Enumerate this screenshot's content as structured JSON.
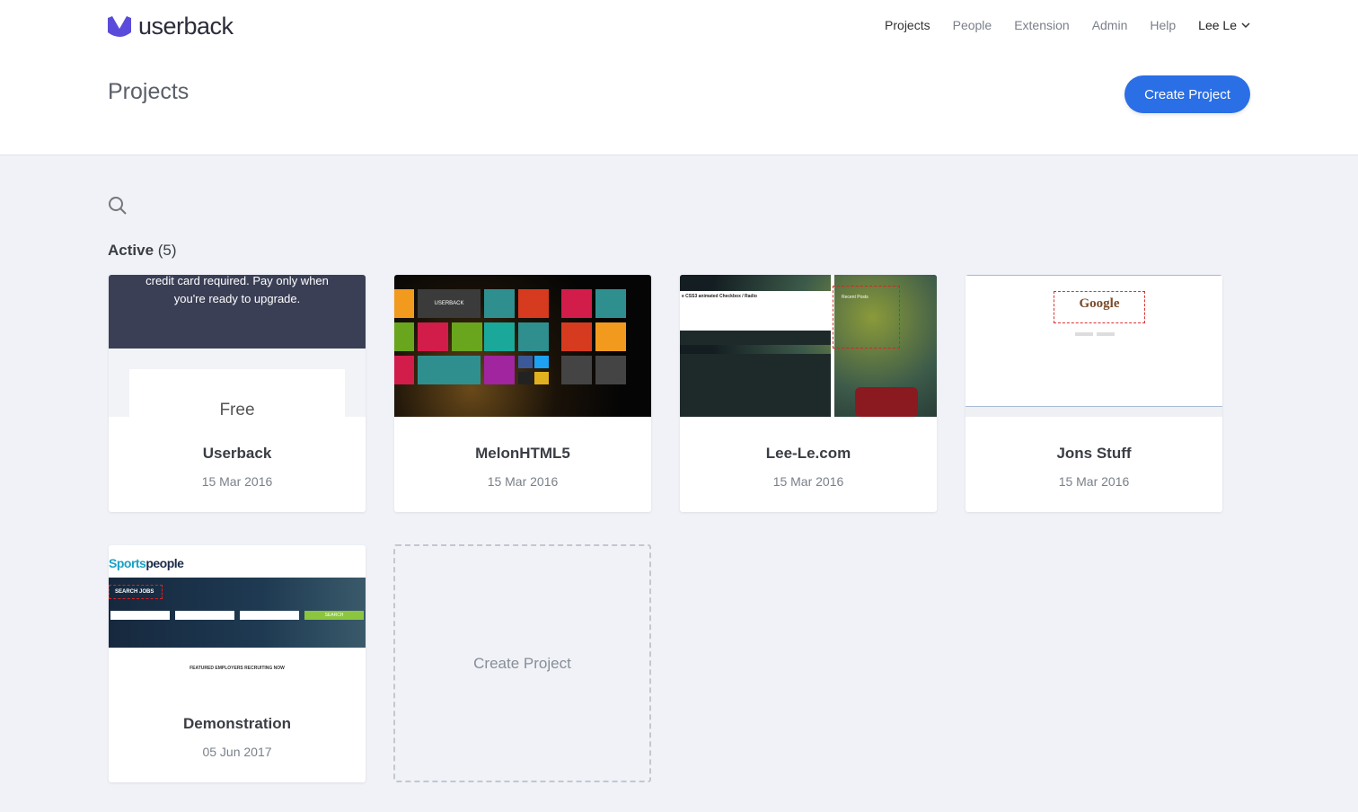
{
  "brand": {
    "name": "userback",
    "color": "#5b4bdb"
  },
  "nav": {
    "items": [
      "Projects",
      "People",
      "Extension",
      "Admin",
      "Help"
    ],
    "user": "Lee Le"
  },
  "header": {
    "title": "Projects",
    "create_label": "Create Project"
  },
  "section": {
    "label": "Active",
    "count": "(5)"
  },
  "projects": [
    {
      "name": "Userback",
      "date": "15 Mar 2016",
      "thumb": {
        "banner_line1": "credit card required. Pay only when",
        "banner_line2": "you're ready to upgrade.",
        "plan": "Free"
      }
    },
    {
      "name": "MelonHTML5",
      "date": "15 Mar 2016",
      "thumb": {
        "tile_label": "USERBACK"
      }
    },
    {
      "name": "Lee-Le.com",
      "date": "15 Mar 2016",
      "thumb": {
        "heading": "e CSS3 animated Checkbox / Radio",
        "side": "Recent Posts"
      }
    },
    {
      "name": "Jons Stuff",
      "date": "15 Mar 2016",
      "thumb": {
        "logo": "Google"
      }
    },
    {
      "name": "Demonstration",
      "date": "05 Jun 2017",
      "thumb": {
        "brand_a": "Sports",
        "brand_b": "people",
        "search": "SEARCH JOBS",
        "featured": "FEATURED EMPLOYERS RECRUITING NOW",
        "cta": "SEARCH"
      }
    }
  ],
  "new_project": {
    "label": "Create Project"
  },
  "colors": {
    "accent": "#2a6fe6",
    "background": "#f0f2f8"
  }
}
